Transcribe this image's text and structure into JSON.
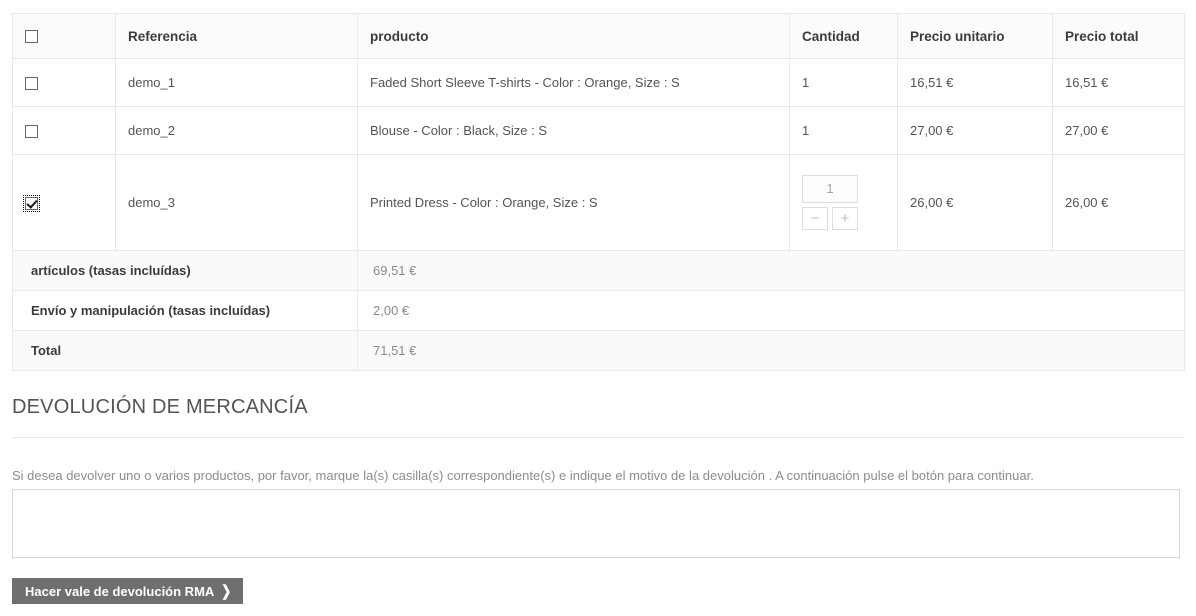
{
  "order_table": {
    "columns": [
      {
        "key": "select",
        "label": ""
      },
      {
        "key": "ref",
        "label": "Referencia"
      },
      {
        "key": "product",
        "label": "producto"
      },
      {
        "key": "qty",
        "label": "Cantidad"
      },
      {
        "key": "unit",
        "label": "Precio unitario"
      },
      {
        "key": "total",
        "label": "Precio total"
      }
    ],
    "header_select_all_checked": false,
    "rows": [
      {
        "checked": false,
        "reference": "demo_1",
        "product": "Faded Short Sleeve T-shirts - Color : Orange, Size : S",
        "quantity": "1",
        "quantity_editable": false,
        "unit_price": "16,51 €",
        "total_price": "16,51 €"
      },
      {
        "checked": false,
        "reference": "demo_2",
        "product": "Blouse - Color : Black, Size : S",
        "quantity": "1",
        "quantity_editable": false,
        "unit_price": "27,00 €",
        "total_price": "27,00 €"
      },
      {
        "checked": true,
        "reference": "demo_3",
        "product": "Printed Dress - Color : Orange, Size : S",
        "quantity": "1",
        "quantity_editable": true,
        "stepper_decrement_label": "−",
        "stepper_increment_label": "+",
        "unit_price": "26,00 €",
        "total_price": "26,00 €"
      }
    ],
    "summary": [
      {
        "label": "artículos (tasas incluídas)",
        "value": "69,51 €"
      },
      {
        "label": "Envío y manipulación (tasas incluídas)",
        "value": "2,00 €"
      },
      {
        "label": "Total",
        "value": "71,51 €"
      }
    ]
  },
  "return_section": {
    "title": "DEVOLUCIÓN DE MERCANCÍA",
    "instructions": "Si desea devolver uno o varios productos, por favor, marque la(s) casilla(s) correspondiente(s) e indique el motivo de la devolución . A continuación pulse el botón para continuar.",
    "reason_value": "",
    "reason_placeholder": "",
    "submit_label": "Hacer vale de devolución RMA",
    "submit_chevron": "❯"
  },
  "colors": {
    "button_bg": "#6f6f6f",
    "header_bg": "#fbfbfb",
    "border": "#e9e9e9",
    "text": "#555454",
    "muted_text": "#8c8c8c"
  }
}
